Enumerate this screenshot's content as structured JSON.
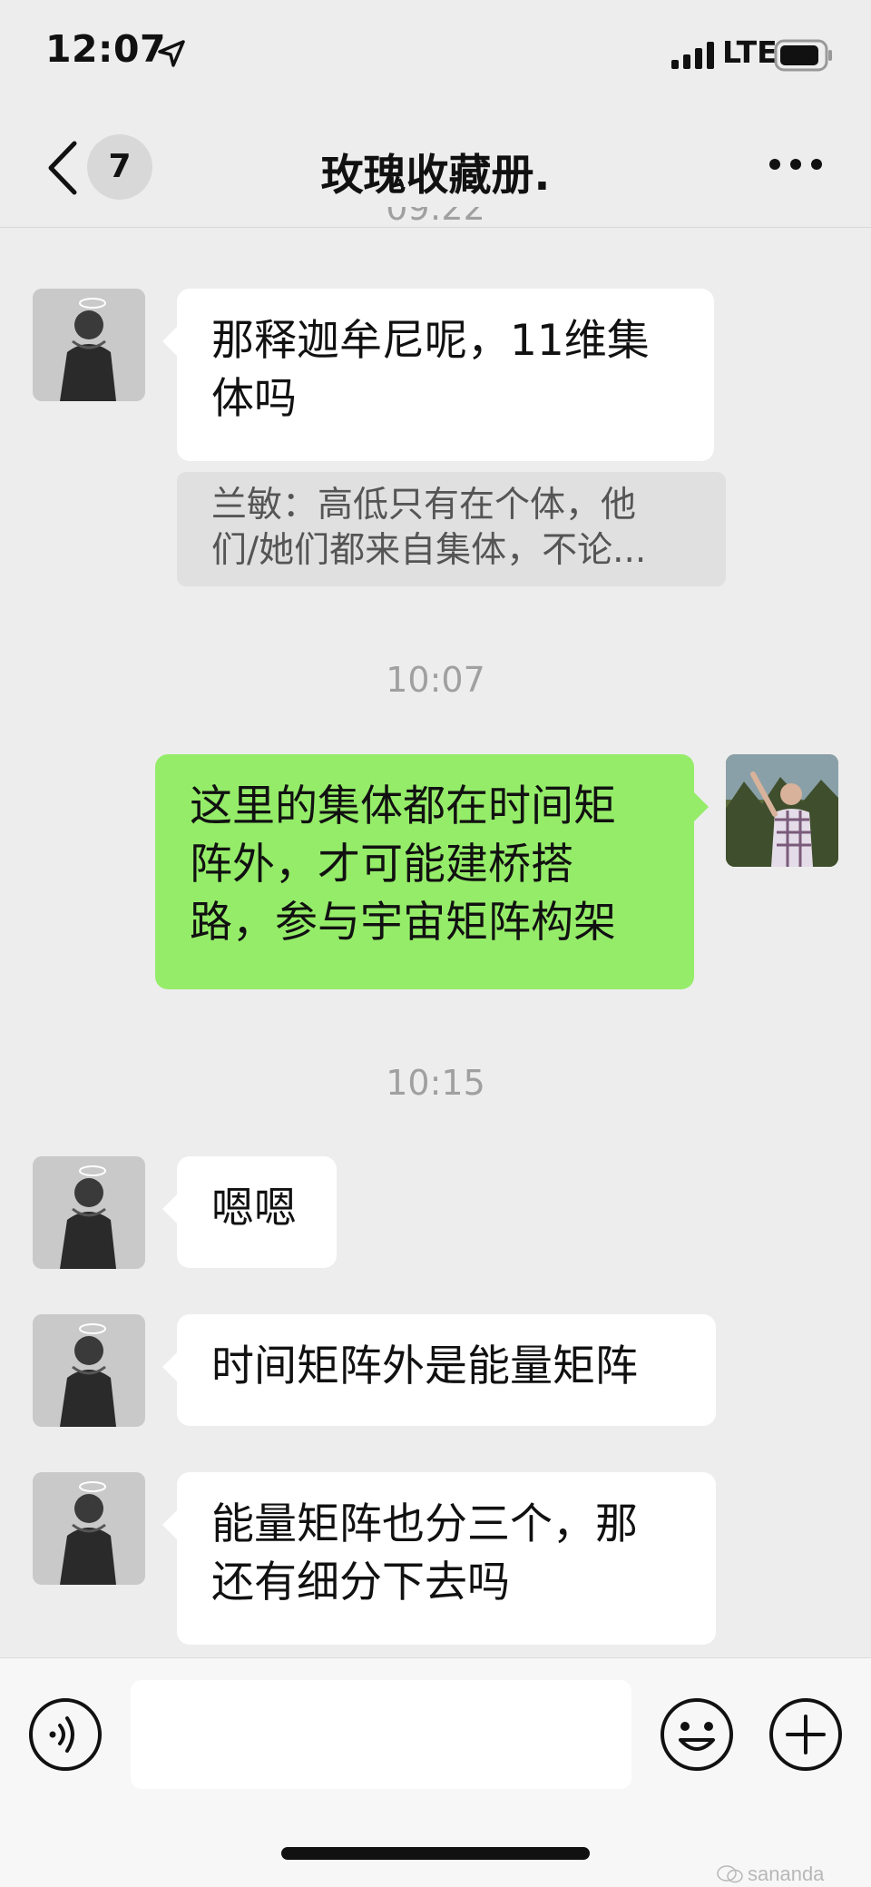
{
  "status_bar": {
    "time": "12:07",
    "network": "LTE",
    "icons": [
      "location-arrow-icon",
      "signal-bars-icon",
      "battery-icon"
    ]
  },
  "nav": {
    "back_icon": "chevron-left-icon",
    "unread_count": "7",
    "title": "玫瑰收藏册.",
    "more_icon": "more-dots-icon"
  },
  "partial_timestamp": "09:22",
  "messages": [
    {
      "side": "incoming",
      "text_lines": [
        "那释迦牟尼呢，11维集",
        "体吗"
      ]
    },
    {
      "side": "quote",
      "text_lines": [
        "兰敏：高低只有在个体，他",
        "们/她们都来自集体，不论..."
      ]
    },
    {
      "side": "timestamp",
      "text": "10:07"
    },
    {
      "side": "outgoing",
      "text_lines": [
        "这里的集体都在时间矩",
        "阵外，才可能建桥搭",
        "路，参与宇宙矩阵构架"
      ]
    },
    {
      "side": "timestamp",
      "text": "10:15"
    },
    {
      "side": "incoming",
      "text_lines": [
        "嗯嗯"
      ]
    },
    {
      "side": "incoming",
      "text_lines": [
        "时间矩阵外是能量矩阵"
      ]
    },
    {
      "side": "incoming",
      "text_lines": [
        "能量矩阵也分三个，那",
        "还有细分下去吗"
      ]
    }
  ],
  "input_bar": {
    "voice_icon": "voice-icon",
    "input_value": "",
    "emoji_icon": "emoji-icon",
    "add_icon": "add-icon"
  },
  "watermark": "sananda",
  "colors": {
    "background": "#ededed",
    "incoming_bubble": "#ffffff",
    "outgoing_bubble": "#95ec69",
    "quote_bubble": "#e0e0e0",
    "timestamp_text": "#a0a0a0"
  }
}
